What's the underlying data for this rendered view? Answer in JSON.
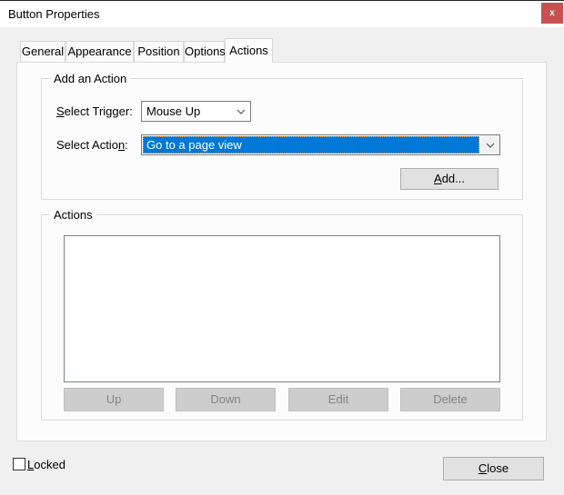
{
  "window": {
    "title": "Button Properties",
    "close_glyph": "x"
  },
  "tabs": [
    "General",
    "Appearance",
    "Position",
    "Options",
    "Actions"
  ],
  "active_tab": "Actions",
  "add_action": {
    "legend": "Add an Action",
    "trigger_label_key": "S",
    "trigger_label_rest": "elect Trigger:",
    "trigger_value": "Mouse Up",
    "action_label_pre": "Select Actio",
    "action_label_key": "n",
    "action_label_post": ":",
    "action_value": "Go to a page view",
    "add_button_key": "A",
    "add_button_rest": "dd..."
  },
  "actions": {
    "legend": "Actions",
    "list_items": [],
    "buttons": [
      "Up",
      "Down",
      "Edit",
      "Delete"
    ],
    "buttons_enabled": false
  },
  "footer": {
    "locked_label_key": "L",
    "locked_label_rest": "ocked",
    "locked_checked": false,
    "close_button_key": "C",
    "close_button_rest": "lose"
  },
  "colors": {
    "selection_blue": "#0078d7",
    "close_button_red": "#c75050",
    "dialog_background": "#f0f0f0"
  }
}
